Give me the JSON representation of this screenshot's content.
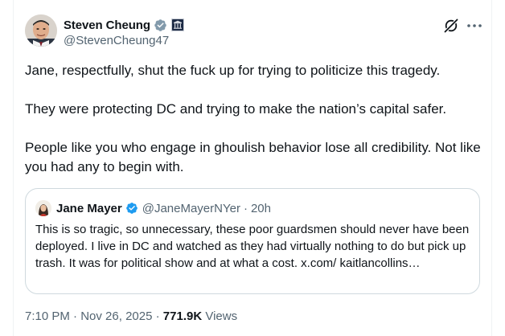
{
  "author": {
    "display_name": "Steven Cheung",
    "handle": "@StevenCheung47",
    "avatar_icon": "avatar-photo",
    "verified_icon": "verified-badge-icon",
    "affiliation_icon": "government-affiliation-icon"
  },
  "actions": {
    "grok_icon": "grok-icon",
    "more_icon": "more-options-icon"
  },
  "tweet": {
    "paragraphs": [
      "Jane, respectfully, shut the fuck up for trying to politicize this tragedy.",
      "They were protecting DC and trying to make the nation’s capital safer.",
      "People like you who engage in ghoulish behavior lose all credibility. Not like you had any to begin with."
    ]
  },
  "quote": {
    "display_name": "Jane Mayer",
    "handle": "@JaneMayerNYer",
    "separator": "·",
    "time": "20h",
    "text": "This is so tragic, so unnecessary, these poor guardsmen should never have been deployed. I live in DC and watched as they had virtually nothing to do but pick up trash. It was for political show and at what a cost. x.com/ kaitlancollins…"
  },
  "meta": {
    "time": "7:10 PM",
    "date": "Nov 26, 2025",
    "separator": "·",
    "views_count": "771.9K",
    "views_label": "Views"
  },
  "colors": {
    "primary_text": "#0f1419",
    "secondary_text": "#536471",
    "verified_blue": "#1d9bf0",
    "border": "#cfd9de"
  }
}
